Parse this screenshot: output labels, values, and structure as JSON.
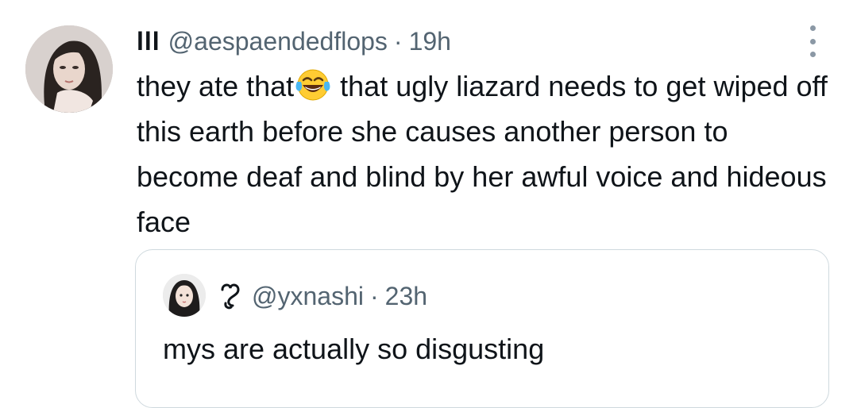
{
  "tweet": {
    "display_name": "lll",
    "handle": "@aespaendedflops",
    "separator": "·",
    "time": "19h",
    "text_before_emoji": "they ate that",
    "emoji_icon": "face-with-tears-of-joy-icon",
    "text_after_emoji": " that ugly liazard needs to get wiped off this earth before she causes another person to become deaf and blind by her awful voice and hideous face"
  },
  "quoted_tweet": {
    "name_icon": "squiggle-symbol-icon",
    "handle": "@yxnashi",
    "separator": "·",
    "time": "23h",
    "text": "mys are actually so disgusting"
  },
  "colors": {
    "text_primary": "#0f1419",
    "text_secondary": "#536471",
    "border": "#cfd9de"
  }
}
